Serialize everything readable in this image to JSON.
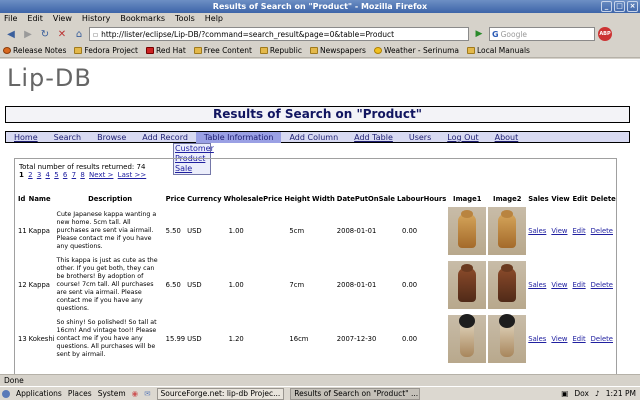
{
  "window": {
    "title": "Results of Search on \"Product\" - Mozilla Firefox"
  },
  "menu": [
    "File",
    "Edit",
    "View",
    "History",
    "Bookmarks",
    "Tools",
    "Help"
  ],
  "nav": {
    "url": "http://lister/eclipse/Lip-DB/?command=search_result&page=0&table=Product",
    "search_placeholder": "Google"
  },
  "bookmarks": [
    "Release Notes",
    "Fedora Project",
    "Red Hat",
    "Free Content",
    "Republic",
    "Newspapers",
    "Weather - Serinuma",
    "Local Manuals"
  ],
  "app": {
    "logo": "Lip-DB",
    "page_title": "Results of Search on \"Product\"",
    "nav_items": [
      "Home",
      "Search",
      "Browse",
      "Add Record",
      "Table Information",
      "Add Column",
      "Add Table",
      "Users",
      "Log Out",
      "About"
    ],
    "dropdown": [
      "Customer",
      "Product",
      "Sale"
    ],
    "result_count": "Total number of results returned: 74",
    "pager": {
      "current": "1",
      "pages": [
        "2",
        "3",
        "4",
        "5",
        "6",
        "7",
        "8"
      ],
      "next": "Next >",
      "last": "Last >>"
    },
    "columns": [
      "Id",
      "Name",
      "Description",
      "Price",
      "Currency",
      "WholesalePrice",
      "Height",
      "Width",
      "DatePutOnSale",
      "LabourHours",
      "Image1",
      "Image2",
      "Sales",
      "View",
      "Edit",
      "Delete"
    ],
    "rows": [
      {
        "id": "11",
        "name": "Kappa",
        "description": "Cute Japanese kappa wanting a new home. 5cm tall. All purchases are sent via airmail. Please contact me if you have any questions.",
        "price": "5.50",
        "currency": "USD",
        "wholesale": "1.00",
        "height": "5cm",
        "width": "",
        "date": "2008-01-01",
        "labour": "0.00",
        "sales": "Sales",
        "view": "View",
        "edit": "Edit",
        "delete": "Delete"
      },
      {
        "id": "12",
        "name": "Kappa",
        "description": "This kappa is just as cute as the other. If you get both, they can be brothers! By adoption of course! 7cm tall. All purchases are sent via airmail. Please contact me if you have any questions.",
        "price": "6.50",
        "currency": "USD",
        "wholesale": "1.00",
        "height": "7cm",
        "width": "",
        "date": "2008-01-01",
        "labour": "0.00",
        "sales": "Sales",
        "view": "View",
        "edit": "Edit",
        "delete": "Delete"
      },
      {
        "id": "13",
        "name": "Kokeshi",
        "description": "So shiny! So polished! So tall at 16cm! And vintage too!! Please contact me if you have any questions. All purchases will be sent by airmail.",
        "price": "15.99",
        "currency": "USD",
        "wholesale": "1.20",
        "height": "16cm",
        "width": "",
        "date": "2007-12-30",
        "labour": "0.00",
        "sales": "Sales",
        "view": "View",
        "edit": "Edit",
        "delete": "Delete"
      }
    ]
  },
  "status": "Done",
  "taskbar": {
    "items": [
      "Applications",
      "Places",
      "System"
    ],
    "windows": [
      "SourceForge.net: lip-db Projec...",
      "Results of Search on \"Product\" ..."
    ],
    "user": "Dox",
    "time": "1:21 PM"
  }
}
